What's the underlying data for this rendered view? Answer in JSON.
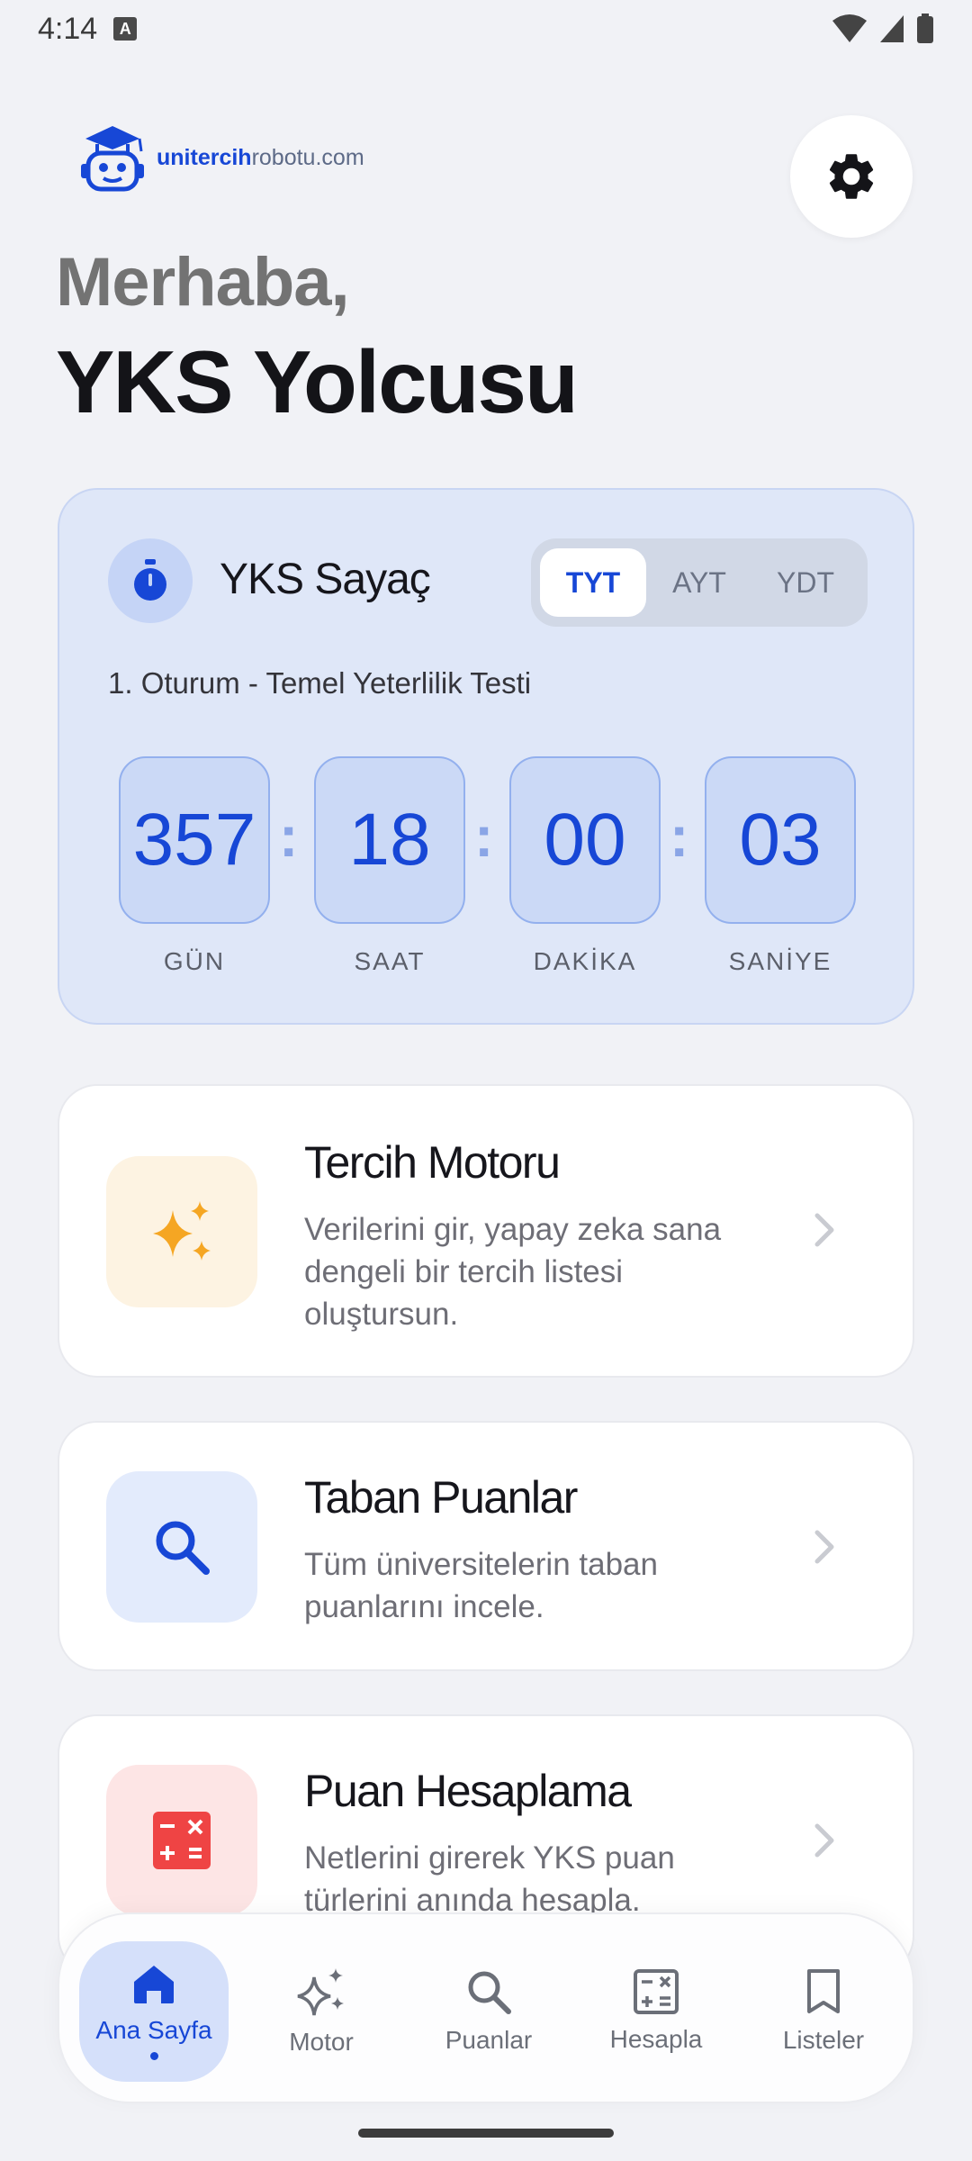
{
  "status_bar": {
    "time": "4:14",
    "notif_letter": "A"
  },
  "header": {
    "logo_bold": "unitercih",
    "logo_light": "robotu.com",
    "greeting": "Merhaba,",
    "title": "YKS Yolcusu"
  },
  "counter": {
    "title": "YKS Sayaç",
    "tabs": [
      "TYT",
      "AYT",
      "YDT"
    ],
    "active_tab": "TYT",
    "session": "1. Oturum - Temel Yeterlilik Testi",
    "units": [
      {
        "value": "357",
        "label": "GÜN"
      },
      {
        "value": "18",
        "label": "SAAT"
      },
      {
        "value": "00",
        "label": "DAKİKA"
      },
      {
        "value": "03",
        "label": "SANİYE"
      }
    ]
  },
  "cards": [
    {
      "title": "Tercih Motoru",
      "desc": "Verilerini gir, yapay zeka sana dengeli bir tercih listesi oluştursun.",
      "icon": "sparkles-icon",
      "color": "#f5a623"
    },
    {
      "title": "Taban Puanlar",
      "desc": "Tüm üniversitelerin taban puanlarını incele.",
      "icon": "search-icon",
      "color": "#1747d6"
    },
    {
      "title": "Puan Hesaplama",
      "desc": "Netlerini girerek YKS puan türlerini anında hesapla.",
      "icon": "calculator-icon",
      "color": "#ef4444"
    }
  ],
  "nav": [
    {
      "label": "Ana Sayfa",
      "icon": "home-icon",
      "active": true
    },
    {
      "label": "Motor",
      "icon": "sparkles-icon"
    },
    {
      "label": "Puanlar",
      "icon": "search-icon"
    },
    {
      "label": "Hesapla",
      "icon": "calculator-icon"
    },
    {
      "label": "Listeler",
      "icon": "bookmark-icon"
    }
  ],
  "colors": {
    "accent": "#1747d6",
    "background": "#f1f2f6",
    "counter_bg": "#dfe7f8"
  }
}
